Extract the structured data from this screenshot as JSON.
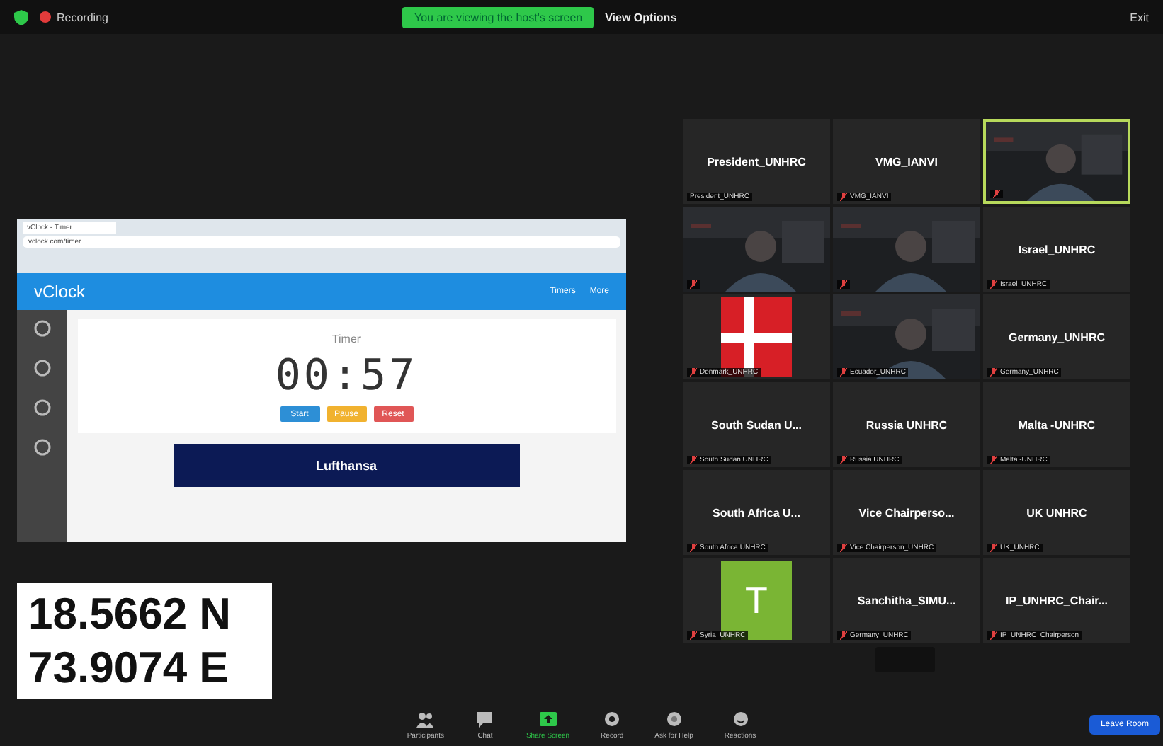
{
  "top_bar": {
    "recording": "Recording",
    "banner": "You are viewing the host's screen",
    "view_options": "View Options",
    "exit": "Exit"
  },
  "shared_screen": {
    "tab_title": "vClock - Timer",
    "address": "vclock.com/timer",
    "brand": "vClock",
    "nav": [
      "Timers",
      "More"
    ],
    "timer_title": "Timer",
    "time": "00:57",
    "buttons": [
      {
        "label": "Start",
        "color": "#2d8fd6"
      },
      {
        "label": "Pause",
        "color": "#f1b22f"
      },
      {
        "label": "Reset",
        "color": "#e05656"
      }
    ],
    "ad": "Lufthansa"
  },
  "tiles": [
    {
      "kind": "name",
      "title": "President_UNHRC",
      "label": "President_UNHRC",
      "muted": false,
      "active": false
    },
    {
      "kind": "name",
      "title": "VMG_IANVI",
      "label": "VMG_IANVI",
      "muted": true,
      "active": false
    },
    {
      "kind": "video",
      "muted": true,
      "active": true
    },
    {
      "kind": "video",
      "muted": true,
      "active": false
    },
    {
      "kind": "video",
      "muted": true,
      "active": false
    },
    {
      "kind": "name",
      "title": "Israel_UNHRC",
      "label": "Israel_UNHRC",
      "muted": true,
      "active": false
    },
    {
      "kind": "flag",
      "label": "Denmark_UNHRC",
      "muted": true,
      "active": false
    },
    {
      "kind": "video",
      "label": "Ecuador_UNHRC",
      "muted": true,
      "active": false
    },
    {
      "kind": "name",
      "title": "Germany_UNHRC",
      "label": "Germany_UNHRC",
      "muted": true,
      "active": false
    },
    {
      "kind": "name",
      "title": "South Sudan U...",
      "label": "South Sudan UNHRC",
      "muted": true,
      "active": false
    },
    {
      "kind": "name",
      "title": "Russia UNHRC",
      "label": "Russia UNHRC",
      "muted": true,
      "active": false
    },
    {
      "kind": "name",
      "title": "Malta -UNHRC",
      "label": "Malta -UNHRC",
      "muted": true,
      "active": false
    },
    {
      "kind": "name",
      "title": "South Africa U...",
      "label": "South Africa UNHRC",
      "muted": true,
      "active": false
    },
    {
      "kind": "name",
      "title": "Vice Chairperso...",
      "label": "Vice Chairperson_UNHRC",
      "muted": true,
      "active": false
    },
    {
      "kind": "name",
      "title": "UK UNHRC",
      "label": "UK_UNHRC",
      "muted": true,
      "active": false
    },
    {
      "kind": "avatar",
      "letter": "T",
      "label": "Syria_UNHRC",
      "muted": true,
      "active": false
    },
    {
      "kind": "name",
      "title": "Sanchitha_SIMU...",
      "label": "Germany_UNHRC",
      "muted": true,
      "active": false
    },
    {
      "kind": "name",
      "title": "IP_UNHRC_Chair...",
      "label": "IP_UNHRC_Chairperson",
      "muted": true,
      "active": false
    }
  ],
  "coordinates": [
    "18.5662 N",
    "73.9074 E"
  ],
  "toolbar": [
    {
      "label": "Participants",
      "kind": "people",
      "on": false
    },
    {
      "label": "Chat",
      "kind": "chat",
      "on": false
    },
    {
      "label": "Share Screen",
      "kind": "share",
      "on": true
    },
    {
      "label": "Record",
      "kind": "record",
      "on": false
    },
    {
      "label": "Ask for Help",
      "kind": "help",
      "on": false
    },
    {
      "label": "Reactions",
      "kind": "smile",
      "on": false
    }
  ],
  "leave_button": "Leave Room"
}
